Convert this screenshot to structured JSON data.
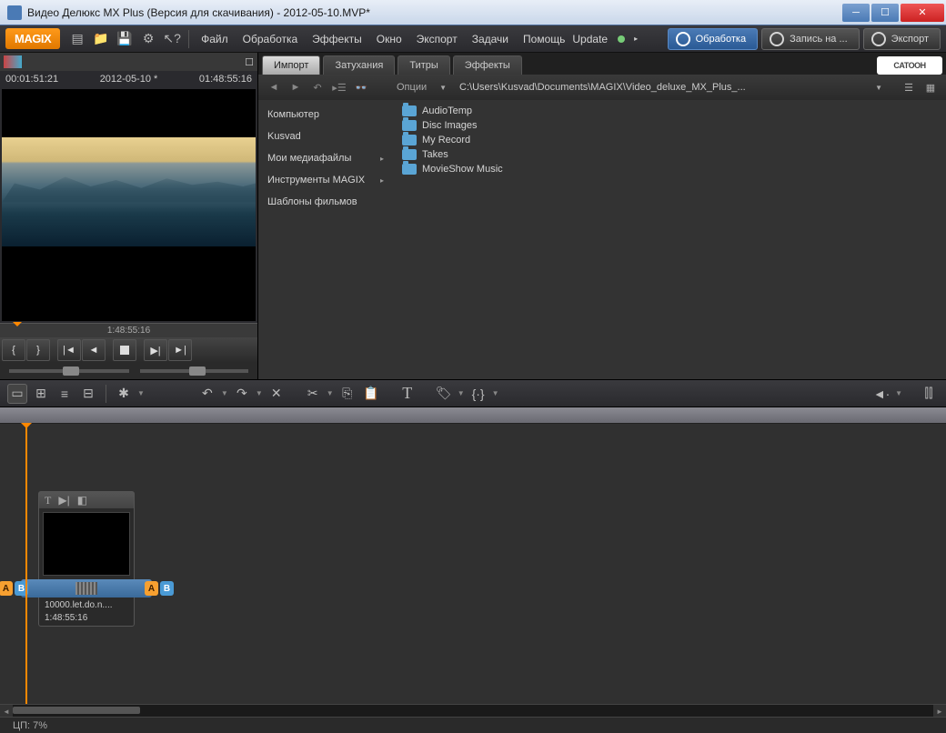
{
  "window": {
    "title": "Видео Делюкс MX Plus (Версия для скачивания) - 2012-05-10.MVP*"
  },
  "brand": "MAGIX",
  "menu": [
    "Файл",
    "Обработка",
    "Эффекты",
    "Окно",
    "Экспорт",
    "Задачи",
    "Помощь",
    "Update"
  ],
  "big_buttons": {
    "process": "Обработка",
    "record": "Запись на ...",
    "export": "Экспорт"
  },
  "preview": {
    "tc_left": "00:01:51:21",
    "tc_center": "2012-05-10 *",
    "tc_right": "01:48:55:16",
    "ruler": "1:48:55:16"
  },
  "pool": {
    "tabs": [
      "Импорт",
      "Затухания",
      "Титры",
      "Эффекты"
    ],
    "catooh": "CATOOH",
    "options": "Опции",
    "path": "C:\\Users\\Kusvad\\Documents\\MAGIX\\Video_deluxe_MX_Plus_...",
    "sources": [
      {
        "label": "Компьютер",
        "arrow": false
      },
      {
        "label": "Kusvad",
        "arrow": false
      },
      {
        "label": "Мои медиафайлы",
        "arrow": true
      },
      {
        "label": "Инструменты MAGIX",
        "arrow": true
      },
      {
        "label": "Шаблоны фильмов",
        "arrow": false
      }
    ],
    "files": [
      "AudioTemp",
      "Disc Images",
      "My Record",
      "Takes",
      "MovieShow Music"
    ]
  },
  "clip": {
    "name": "10000.let.do.n....",
    "time": "1:48:55:16"
  },
  "status": "ЦП:  7%"
}
